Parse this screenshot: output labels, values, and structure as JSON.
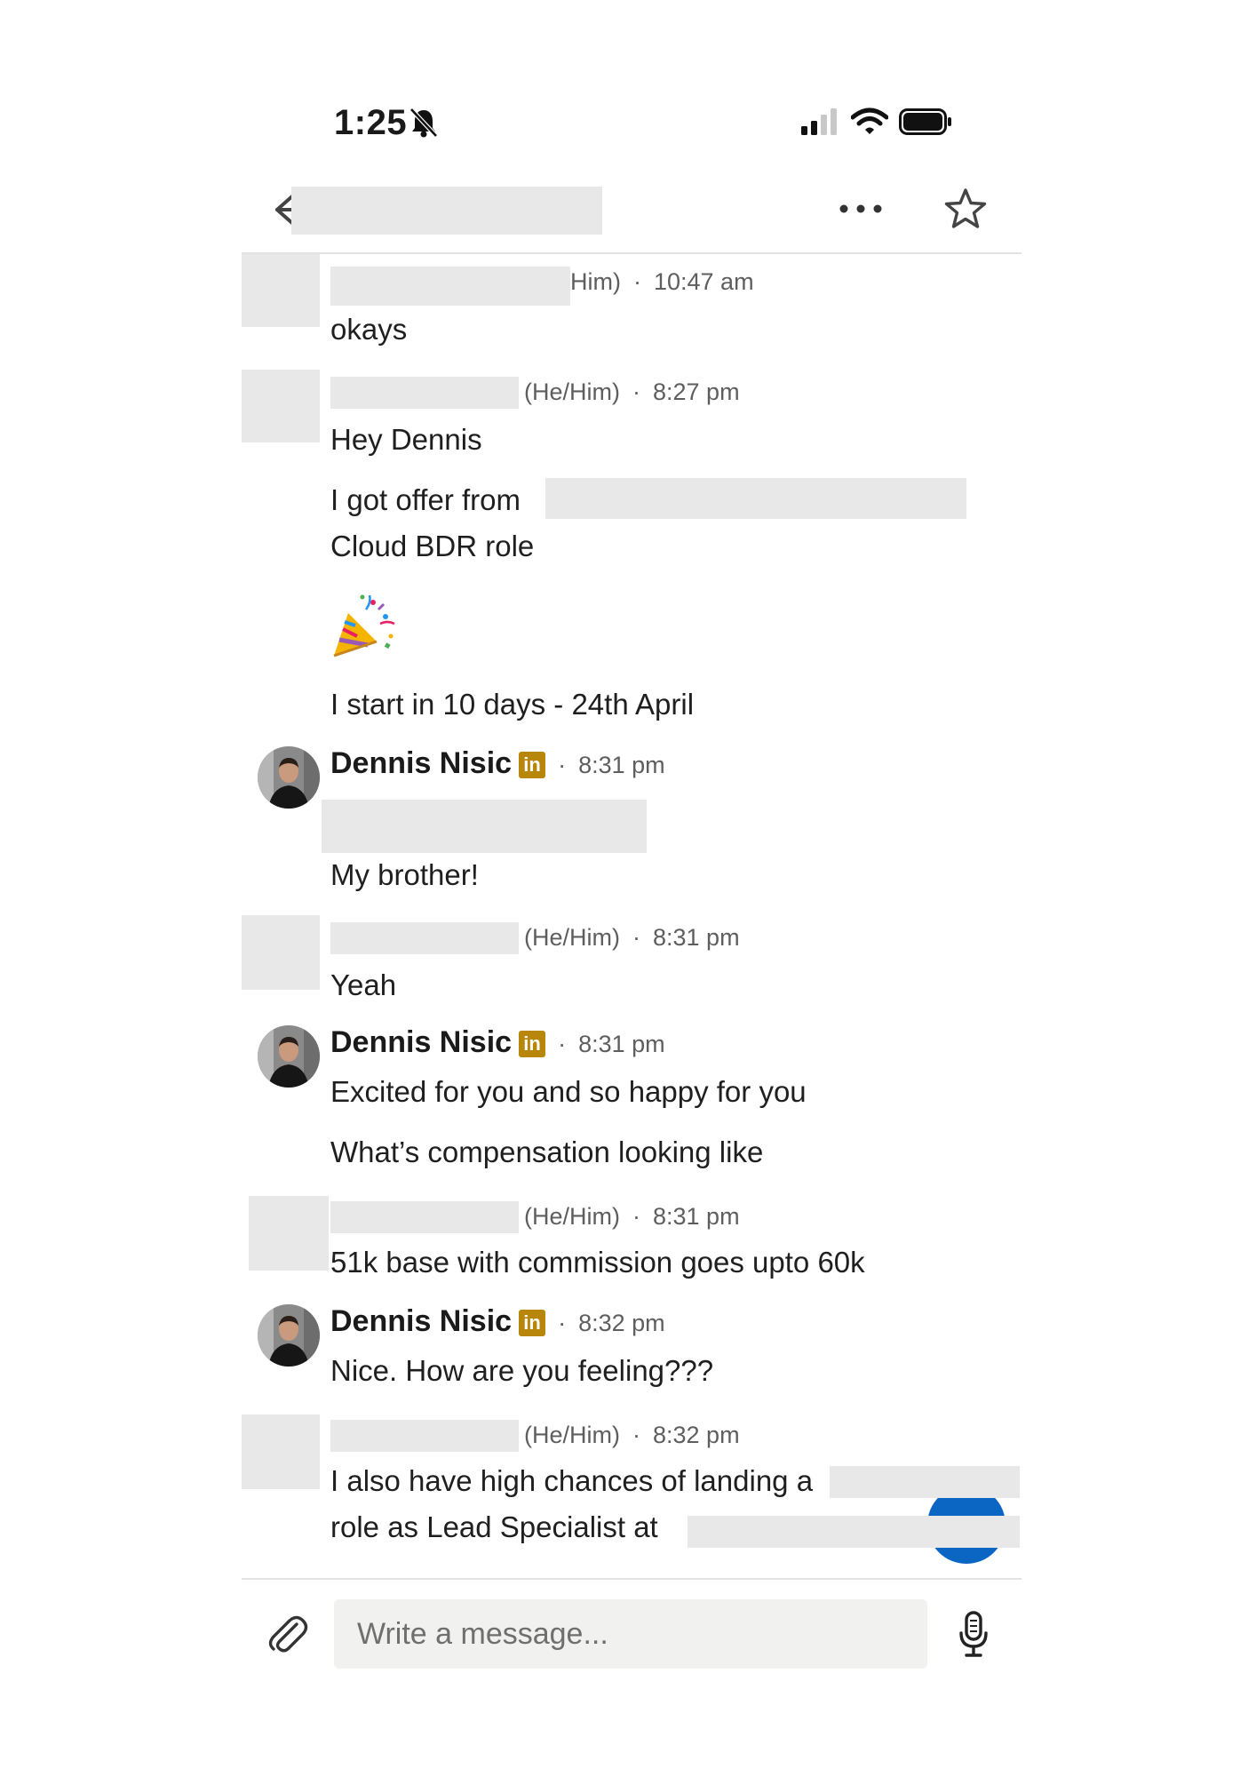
{
  "status_bar": {
    "time": "1:25"
  },
  "messages": {
    "m1": {
      "meta_tail": "Him)",
      "time": "10:47 am",
      "text": "okays"
    },
    "m2": {
      "pronoun": "(He/Him)",
      "time": "8:27 pm",
      "lines": [
        "Hey Dennis",
        "I got offer from",
        "Cloud BDR role",
        "I start in 10 days - 24th April"
      ]
    },
    "m3": {
      "name": "Dennis Nisic",
      "badge": "in",
      "time": "8:31 pm",
      "text": "My brother!"
    },
    "m4": {
      "pronoun": "(He/Him)",
      "time": "8:31 pm",
      "text": "Yeah"
    },
    "m5": {
      "name": "Dennis Nisic",
      "badge": "in",
      "time": "8:31 pm",
      "lines": [
        "Excited for you and so happy for you",
        "What’s compensation looking like"
      ]
    },
    "m6": {
      "pronoun": "(He/Him)",
      "time": "8:31 pm",
      "text": "51k base  with commission goes upto 60k"
    },
    "m7": {
      "name": "Dennis Nisic",
      "badge": "in",
      "time": "8:32 pm",
      "text": "Nice. How are you feeling???"
    },
    "m8": {
      "pronoun": "(He/Him)",
      "time": "8:32 pm",
      "lines": [
        "I also have high chances of landing a",
        "role as Lead Specialist at"
      ]
    }
  },
  "composer": {
    "placeholder": "Write a message..."
  },
  "icons": {
    "back": "back-arrow-icon",
    "more": "more-options-icon",
    "star": "star-icon",
    "attach": "paperclip-icon",
    "mic": "microphone-icon",
    "fab": "plus-icon",
    "bell": "bell-muted-icon",
    "signal": "signal-icon",
    "wifi": "wifi-icon",
    "battery": "battery-icon"
  },
  "colors": {
    "linkedin_badge": "#b8860b",
    "fab": "#0a66c2",
    "redaction": "#e8e8e8"
  }
}
